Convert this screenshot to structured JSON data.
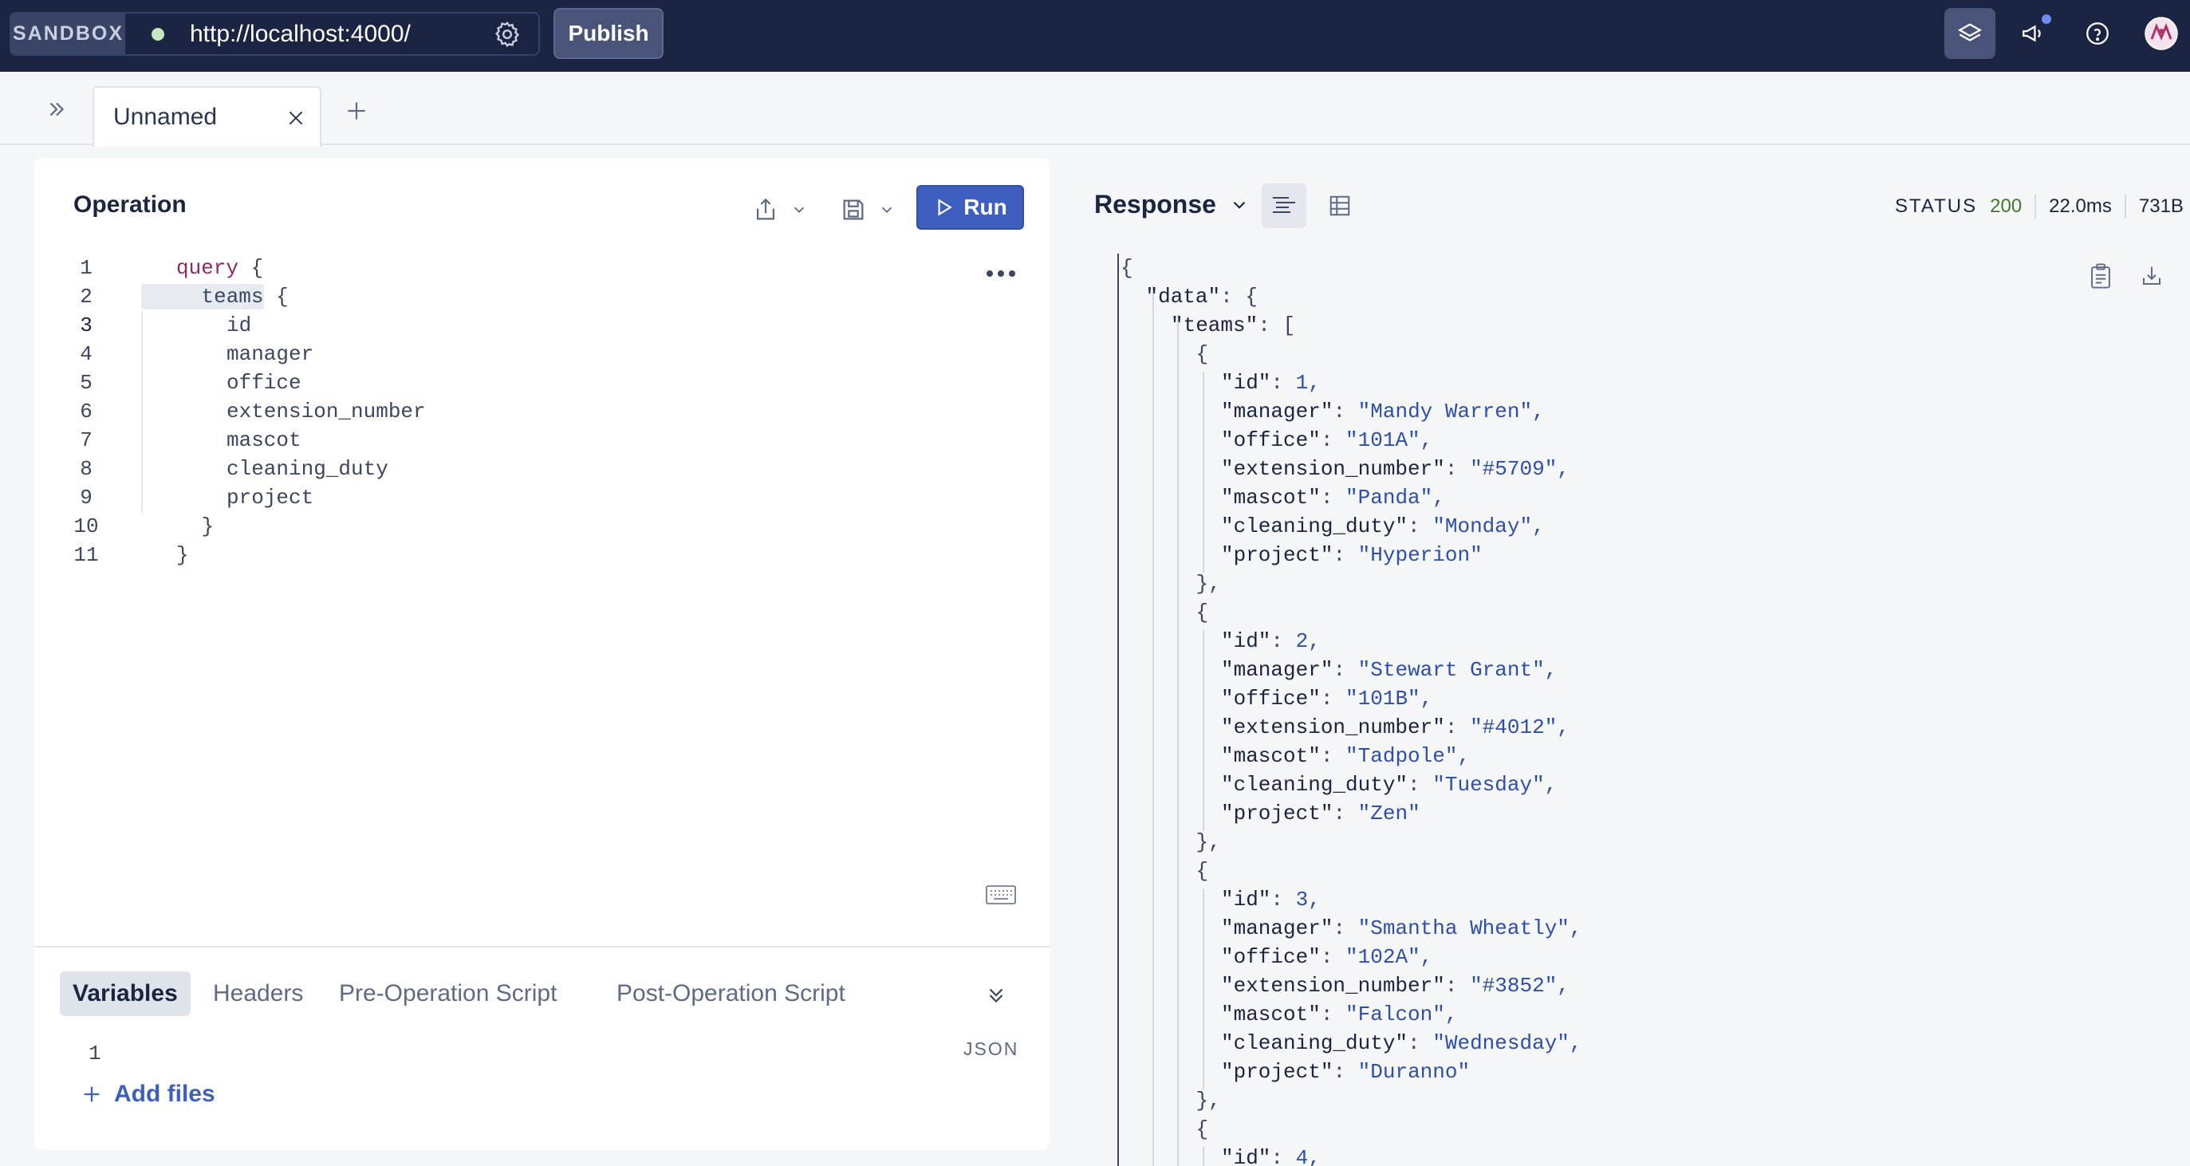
{
  "topbar": {
    "sandbox_label": "SANDBOX",
    "url": "http://localhost:4000/",
    "publish_label": "Publish",
    "icons": [
      "settings-gear-icon",
      "schema-layers-icon",
      "megaphone-icon",
      "help-icon",
      "avatar"
    ],
    "accent_color": "#1b2442"
  },
  "tabs": {
    "items": [
      {
        "title": "Unnamed"
      }
    ]
  },
  "operation": {
    "title": "Operation",
    "run_label": "Run",
    "code_lines": [
      {
        "n": "1",
        "indent": 0,
        "kw": "query",
        "text": " {"
      },
      {
        "n": "2",
        "indent": 1,
        "kw": "",
        "text": "teams {"
      },
      {
        "n": "3",
        "indent": 2,
        "kw": "",
        "text": "id"
      },
      {
        "n": "4",
        "indent": 2,
        "kw": "",
        "text": "manager"
      },
      {
        "n": "5",
        "indent": 2,
        "kw": "",
        "text": "office"
      },
      {
        "n": "6",
        "indent": 2,
        "kw": "",
        "text": "extension_number"
      },
      {
        "n": "7",
        "indent": 2,
        "kw": "",
        "text": "mascot"
      },
      {
        "n": "8",
        "indent": 2,
        "kw": "",
        "text": "cleaning_duty"
      },
      {
        "n": "9",
        "indent": 2,
        "kw": "",
        "text": "project"
      },
      {
        "n": "10",
        "indent": 1,
        "kw": "",
        "text": "}"
      },
      {
        "n": "11",
        "indent": 0,
        "kw": "",
        "text": "}"
      }
    ],
    "subtabs": [
      "Variables",
      "Headers",
      "Pre-Operation Script",
      "Post-Operation Script"
    ],
    "active_subtab": "Variables",
    "variables_line": "1",
    "variables_format": "JSON",
    "add_files_label": "Add files"
  },
  "response": {
    "title": "Response",
    "status_label": "STATUS",
    "status_code": "200",
    "time": "22.0ms",
    "size": "731B",
    "lines": [
      {
        "d": 0,
        "k": "",
        "v": "{",
        "t": "p"
      },
      {
        "d": 1,
        "k": "\"data\"",
        "v": "{",
        "t": "p"
      },
      {
        "d": 2,
        "k": "\"teams\"",
        "v": "[",
        "t": "p"
      },
      {
        "d": 3,
        "k": "",
        "v": "{",
        "t": "p"
      },
      {
        "d": 4,
        "k": "\"id\"",
        "v": "1,",
        "t": "n"
      },
      {
        "d": 4,
        "k": "\"manager\"",
        "v": "\"Mandy Warren\",",
        "t": "s"
      },
      {
        "d": 4,
        "k": "\"office\"",
        "v": "\"101A\",",
        "t": "s"
      },
      {
        "d": 4,
        "k": "\"extension_number\"",
        "v": "\"#5709\",",
        "t": "s"
      },
      {
        "d": 4,
        "k": "\"mascot\"",
        "v": "\"Panda\",",
        "t": "s"
      },
      {
        "d": 4,
        "k": "\"cleaning_duty\"",
        "v": "\"Monday\",",
        "t": "s"
      },
      {
        "d": 4,
        "k": "\"project\"",
        "v": "\"Hyperion\"",
        "t": "s"
      },
      {
        "d": 3,
        "k": "",
        "v": "},",
        "t": "p"
      },
      {
        "d": 3,
        "k": "",
        "v": "{",
        "t": "p"
      },
      {
        "d": 4,
        "k": "\"id\"",
        "v": "2,",
        "t": "n"
      },
      {
        "d": 4,
        "k": "\"manager\"",
        "v": "\"Stewart Grant\",",
        "t": "s"
      },
      {
        "d": 4,
        "k": "\"office\"",
        "v": "\"101B\",",
        "t": "s"
      },
      {
        "d": 4,
        "k": "\"extension_number\"",
        "v": "\"#4012\",",
        "t": "s"
      },
      {
        "d": 4,
        "k": "\"mascot\"",
        "v": "\"Tadpole\",",
        "t": "s"
      },
      {
        "d": 4,
        "k": "\"cleaning_duty\"",
        "v": "\"Tuesday\",",
        "t": "s"
      },
      {
        "d": 4,
        "k": "\"project\"",
        "v": "\"Zen\"",
        "t": "s"
      },
      {
        "d": 3,
        "k": "",
        "v": "},",
        "t": "p"
      },
      {
        "d": 3,
        "k": "",
        "v": "{",
        "t": "p"
      },
      {
        "d": 4,
        "k": "\"id\"",
        "v": "3,",
        "t": "n"
      },
      {
        "d": 4,
        "k": "\"manager\"",
        "v": "\"Smantha Wheatly\",",
        "t": "s"
      },
      {
        "d": 4,
        "k": "\"office\"",
        "v": "\"102A\",",
        "t": "s"
      },
      {
        "d": 4,
        "k": "\"extension_number\"",
        "v": "\"#3852\",",
        "t": "s"
      },
      {
        "d": 4,
        "k": "\"mascot\"",
        "v": "\"Falcon\",",
        "t": "s"
      },
      {
        "d": 4,
        "k": "\"cleaning_duty\"",
        "v": "\"Wednesday\",",
        "t": "s"
      },
      {
        "d": 4,
        "k": "\"project\"",
        "v": "\"Duranno\"",
        "t": "s"
      },
      {
        "d": 3,
        "k": "",
        "v": "},",
        "t": "p"
      },
      {
        "d": 3,
        "k": "",
        "v": "{",
        "t": "p"
      },
      {
        "d": 4,
        "k": "\"id\"",
        "v": "4,",
        "t": "n"
      }
    ]
  }
}
